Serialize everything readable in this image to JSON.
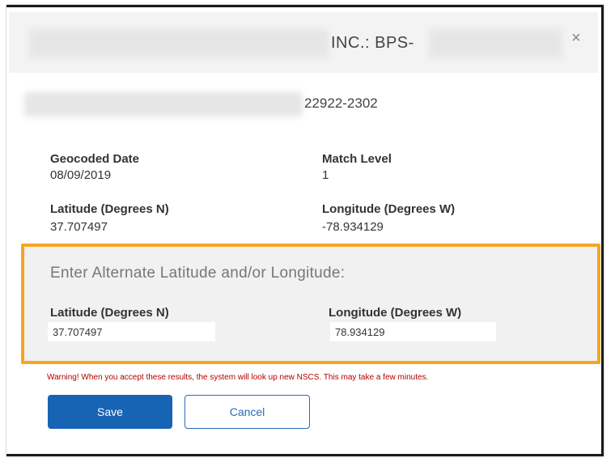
{
  "dialog": {
    "title_suffix": "INC.: BPS-",
    "close_symbol": "×"
  },
  "address": {
    "zip": "22922-2302"
  },
  "details": {
    "geocoded_date_label": "Geocoded Date",
    "geocoded_date_value": "08/09/2019",
    "match_level_label": "Match Level",
    "match_level_value": "1",
    "latitude_label": "Latitude (Degrees N)",
    "latitude_value": "37.707497",
    "longitude_label": "Longitude (Degrees W)",
    "longitude_value": "-78.934129"
  },
  "alternate": {
    "heading": "Enter Alternate Latitude and/or Longitude:",
    "latitude_label": "Latitude (Degrees N)",
    "latitude_input": "37.707497",
    "longitude_label": "Longitude (Degrees W)",
    "longitude_input": "78.934129",
    "highlight_color": "#f5a623"
  },
  "warning": "Warning! When you accept these results, the system will look up new NSCS. This may take a few minutes.",
  "buttons": {
    "save": "Save",
    "cancel": "Cancel"
  },
  "colors": {
    "primary": "#1864b4",
    "warning": "#b40000"
  }
}
